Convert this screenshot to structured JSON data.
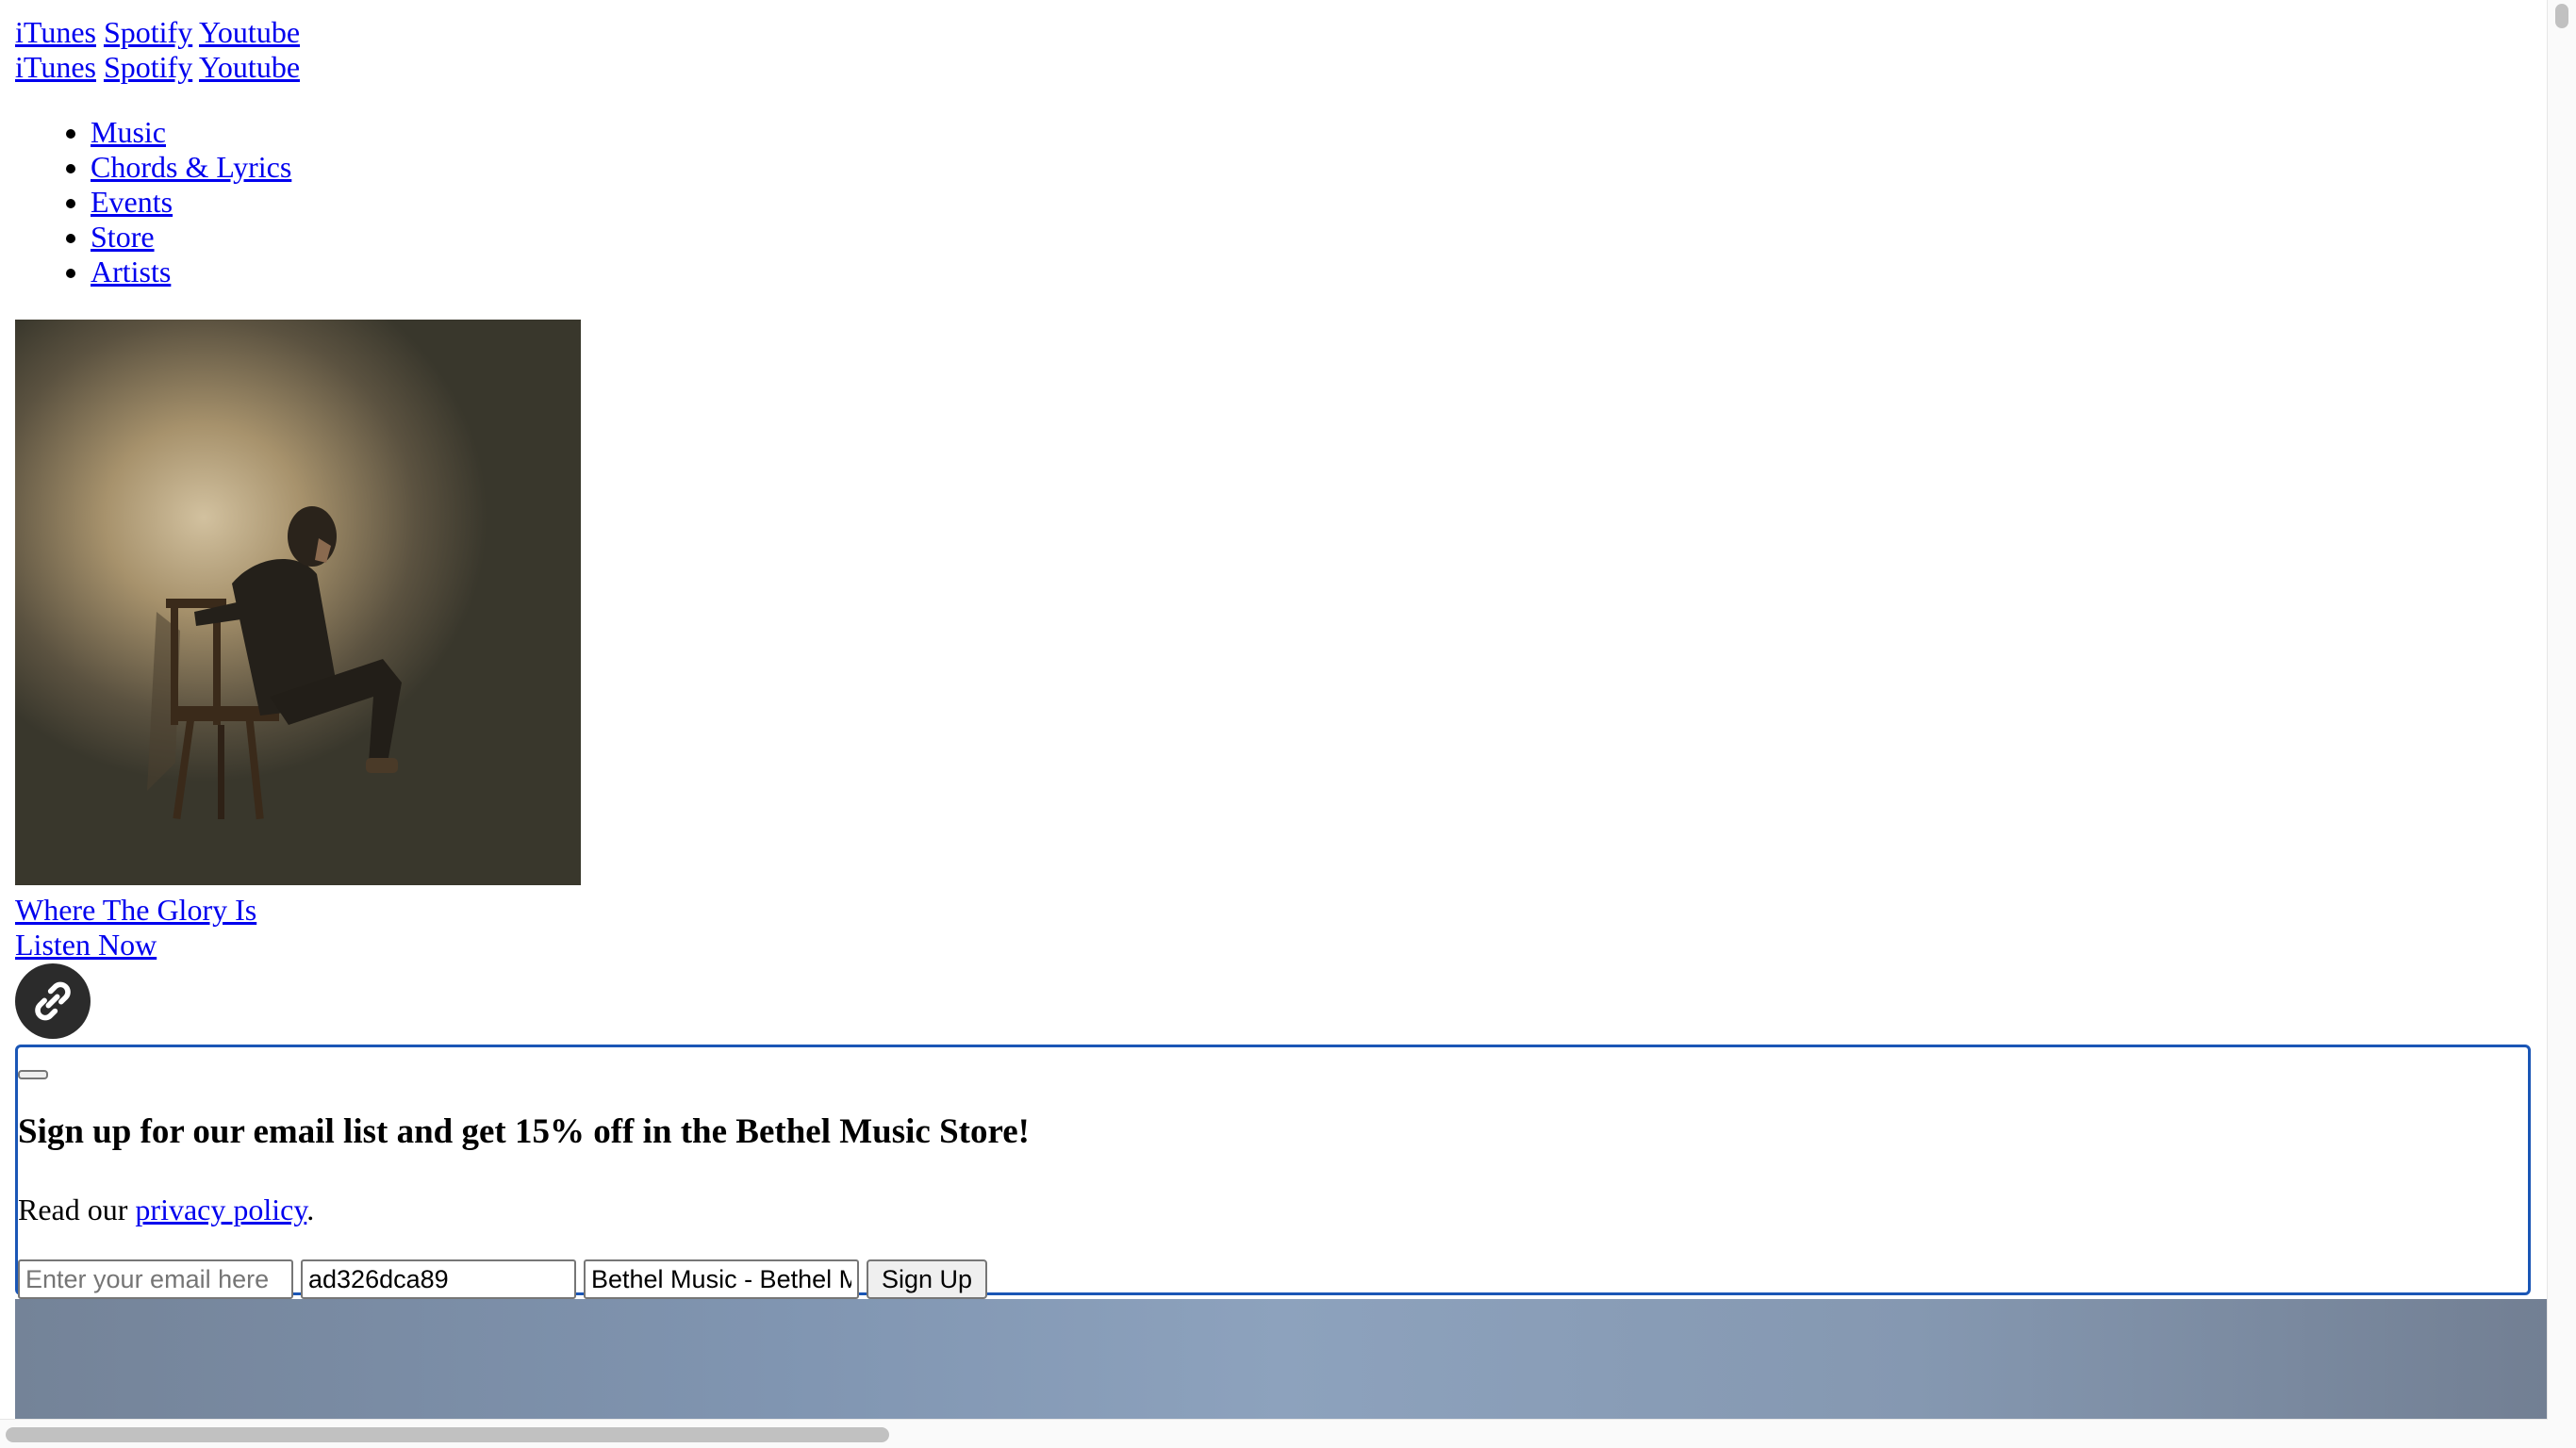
{
  "header": {
    "streaming_links_row1": [
      "iTunes",
      "Spotify",
      "Youtube"
    ],
    "streaming_links_row2": [
      "iTunes",
      "Spotify",
      "Youtube"
    ]
  },
  "nav": {
    "items": [
      "Music",
      "Chords & Lyrics",
      "Events",
      "Store",
      "Artists"
    ]
  },
  "feature": {
    "album_title": "Where The Glory Is",
    "cta": "Listen Now",
    "share_icon": "link-icon"
  },
  "signup": {
    "heading": "Sign up for our email list and get 15% off in the Bethel Music Store!",
    "privacy_prefix": "Read our ",
    "privacy_link": "privacy policy",
    "privacy_suffix": ".",
    "email_placeholder": "Enter your email here",
    "field2_value": "ad326dca89",
    "field3_value": "Bethel Music - Bethel Music",
    "submit_label": "Sign Up",
    "border_color": "#1a56b6"
  }
}
